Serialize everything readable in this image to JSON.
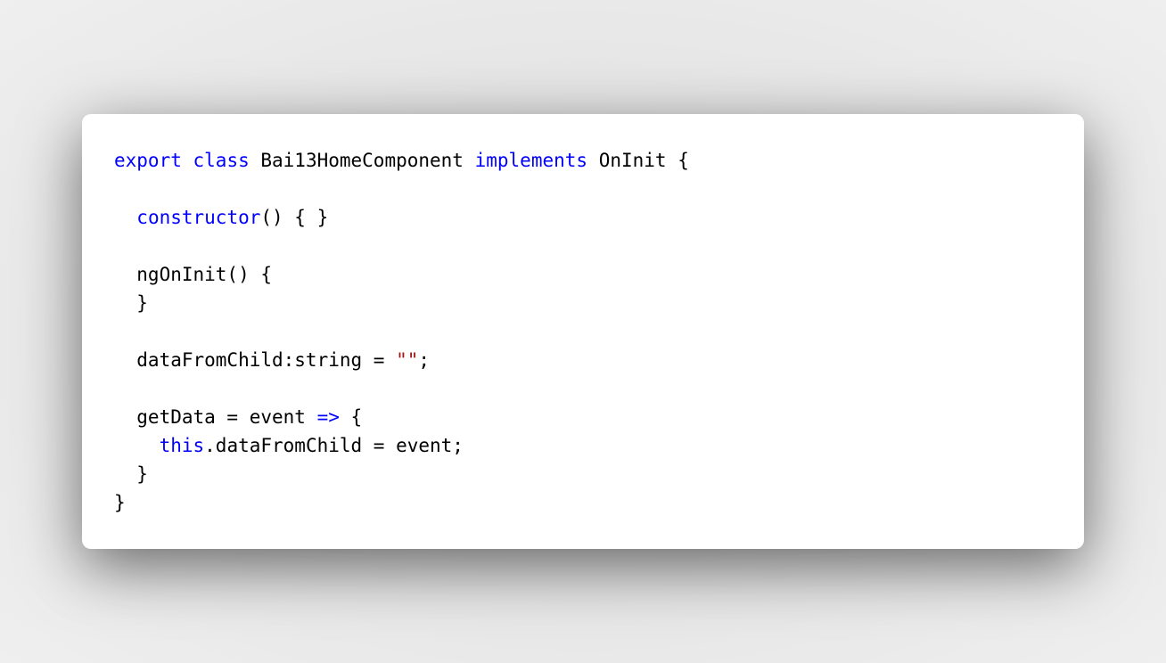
{
  "colors": {
    "keyword": "#0000ff",
    "string": "#a31515",
    "text": "#000000",
    "card_background": "#ffffff"
  },
  "code": {
    "lines": [
      [
        {
          "text": "export",
          "kind": "kw"
        },
        {
          "text": " ",
          "kind": "plain"
        },
        {
          "text": "class",
          "kind": "kw"
        },
        {
          "text": " Bai13HomeComponent ",
          "kind": "plain"
        },
        {
          "text": "implements",
          "kind": "kw"
        },
        {
          "text": " OnInit {",
          "kind": "plain"
        }
      ],
      [],
      [
        {
          "text": "  ",
          "kind": "plain"
        },
        {
          "text": "constructor",
          "kind": "kw"
        },
        {
          "text": "() { }",
          "kind": "plain"
        }
      ],
      [],
      [
        {
          "text": "  ngOnInit() {",
          "kind": "plain"
        }
      ],
      [
        {
          "text": "  }",
          "kind": "plain"
        }
      ],
      [],
      [
        {
          "text": "  dataFromChild:string = ",
          "kind": "plain"
        },
        {
          "text": "\"\"",
          "kind": "str"
        },
        {
          "text": ";",
          "kind": "plain"
        }
      ],
      [],
      [
        {
          "text": "  getData = event ",
          "kind": "plain"
        },
        {
          "text": "=>",
          "kind": "kw"
        },
        {
          "text": " {",
          "kind": "plain"
        }
      ],
      [
        {
          "text": "    ",
          "kind": "plain"
        },
        {
          "text": "this",
          "kind": "kw"
        },
        {
          "text": ".dataFromChild = event;",
          "kind": "plain"
        }
      ],
      [
        {
          "text": "  }",
          "kind": "plain"
        }
      ],
      [
        {
          "text": "}",
          "kind": "plain"
        }
      ]
    ]
  }
}
